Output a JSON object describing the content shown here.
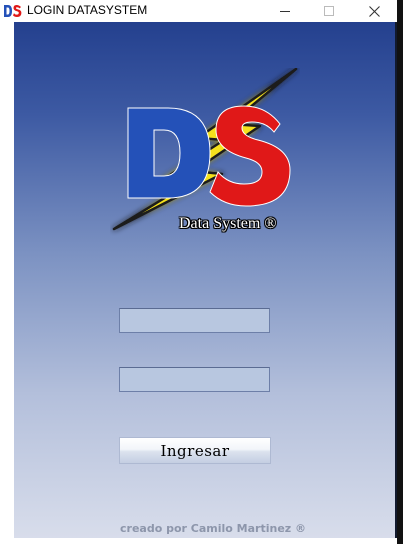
{
  "window": {
    "title": "LOGIN DATASYSTEM",
    "app_icon": "ds-logo-icon",
    "controls": [
      "minimize-icon",
      "maximize-icon",
      "close-icon"
    ]
  },
  "logo": {
    "letters": "DS",
    "brand_text": "Data System ®",
    "colors": {
      "d_letter": "#2451b8",
      "s_letter": "#e01818",
      "bolt": "#f5e11c"
    }
  },
  "form": {
    "username_value": "",
    "password_value": "",
    "submit_label": "Ingresar"
  },
  "footer": {
    "credit": "creado por Camilo Martinez ®"
  },
  "colors": {
    "background_top": "#24408e",
    "background_bottom": "#d8ddeb",
    "input_fill": "#b8c7e0"
  }
}
